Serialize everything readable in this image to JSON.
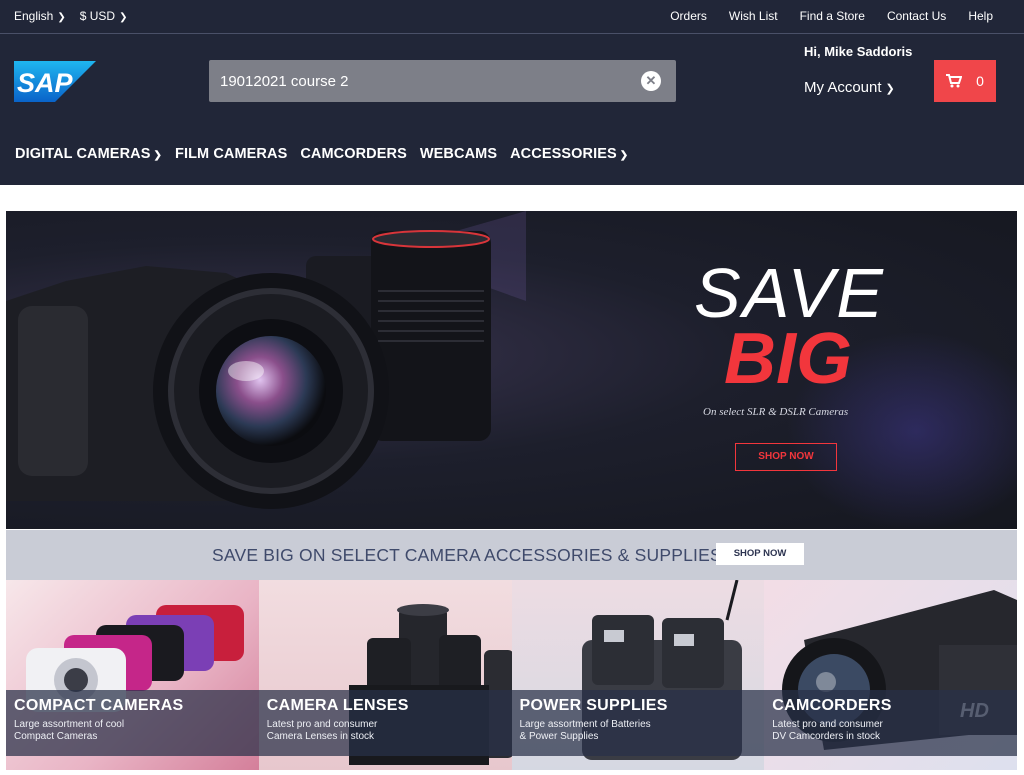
{
  "topbar": {
    "language": "English",
    "currency": "$ USD",
    "links": [
      "Orders",
      "Wish List",
      "Find a Store",
      "Contact Us",
      "Help"
    ]
  },
  "brand": {
    "logo_text": "SAP"
  },
  "search": {
    "value": "19012021 course 2",
    "clear_icon": "close-circle-icon"
  },
  "user": {
    "greeting": "Hi, Mike Saddoris",
    "account_label": "My Account"
  },
  "cart": {
    "count": "0",
    "icon": "cart-icon"
  },
  "nav": {
    "items": [
      {
        "label": "DIGITAL CAMERAS",
        "has_dropdown": true
      },
      {
        "label": "FILM CAMERAS",
        "has_dropdown": false
      },
      {
        "label": "CAMCORDERS",
        "has_dropdown": false
      },
      {
        "label": "WEBCAMS",
        "has_dropdown": false
      },
      {
        "label": "ACCESSORIES",
        "has_dropdown": true
      }
    ]
  },
  "hero": {
    "line1": "SAVE",
    "line2": "BIG",
    "subtitle": "On select SLR & DSLR Cameras",
    "cta": "SHOP NOW"
  },
  "promo": {
    "text": "SAVE BIG ON SELECT CAMERA ACCESSORIES & SUPPLIES",
    "cta": "SHOP NOW"
  },
  "tiles": [
    {
      "title": "COMPACT CAMERAS",
      "desc_line1": "Large assortment of cool",
      "desc_line2": "Compact Cameras"
    },
    {
      "title": "CAMERA LENSES",
      "desc_line1": "Latest pro and consumer",
      "desc_line2": "Camera Lenses in stock"
    },
    {
      "title": "POWER SUPPLIES",
      "desc_line1": "Large assortment of Batteries",
      "desc_line2": "& Power Supplies"
    },
    {
      "title": "CAMCORDERS",
      "desc_line1": "Latest pro and consumer",
      "desc_line2": "DV Camcorders in stock"
    }
  ],
  "colors": {
    "header_bg": "#212638",
    "accent_red": "#f0464a",
    "search_bg": "#7d7f88",
    "strip_bg": "#c9ccd6"
  }
}
